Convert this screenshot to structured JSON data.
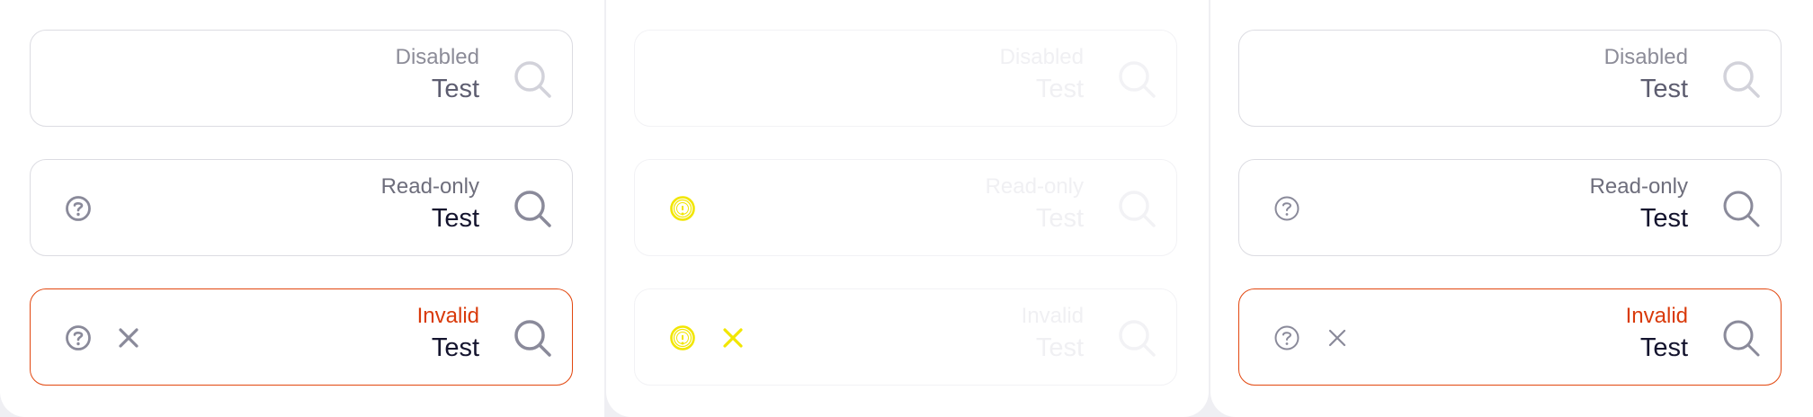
{
  "colors": {
    "border": "#dcdce2",
    "invalid": "#e2470f",
    "icon": "#8a8a9a",
    "ghost_icon": "#f2e600"
  },
  "icons": {
    "search": "search-icon",
    "help": "help-circle-icon",
    "clear": "close-icon"
  },
  "columns": [
    {
      "disabled": {
        "label": "Disabled",
        "value": "Test"
      },
      "readonly": {
        "label": "Read-only",
        "value": "Test"
      },
      "invalid": {
        "label": "Invalid",
        "value": "Test"
      }
    },
    {
      "disabled": {
        "label": "Disabled",
        "value": "Test"
      },
      "readonly": {
        "label": "Read-only",
        "value": "Test"
      },
      "invalid": {
        "label": "Invalid",
        "value": "Test"
      }
    },
    {
      "disabled": {
        "label": "Disabled",
        "value": "Test"
      },
      "readonly": {
        "label": "Read-only",
        "value": "Test"
      },
      "invalid": {
        "label": "Invalid",
        "value": "Test"
      }
    }
  ]
}
